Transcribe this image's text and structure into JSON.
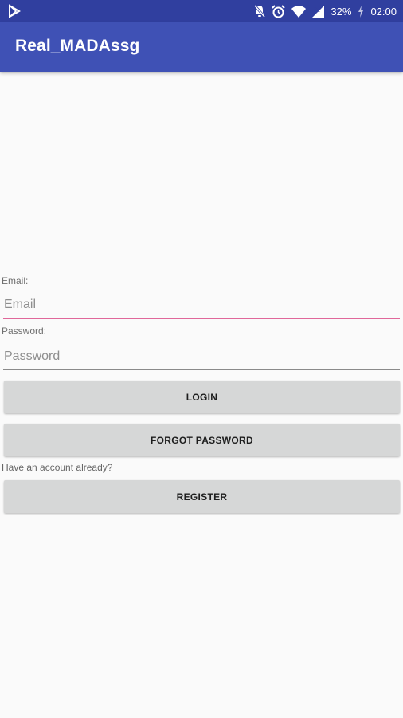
{
  "status_bar": {
    "battery_percent": "32%",
    "time": "02:00",
    "icons": [
      "notifications-off-icon",
      "alarm-icon",
      "wifi-icon",
      "cellular-icon",
      "battery-charging-icon"
    ]
  },
  "app_bar": {
    "title": "Real_MADAssg"
  },
  "form": {
    "email_label": "Email:",
    "email_placeholder": "Email",
    "password_label": "Password:",
    "password_placeholder": "Password",
    "login_button": "LOGIN",
    "forgot_password_button": "FORGOT PASSWORD",
    "account_hint": "Have an account already?",
    "register_button": "REGISTER"
  },
  "colors": {
    "status_bar": "#303f9f",
    "app_bar": "#3f51b5",
    "input_focus": "#e0679a",
    "button_bg": "#d6d7d7"
  }
}
